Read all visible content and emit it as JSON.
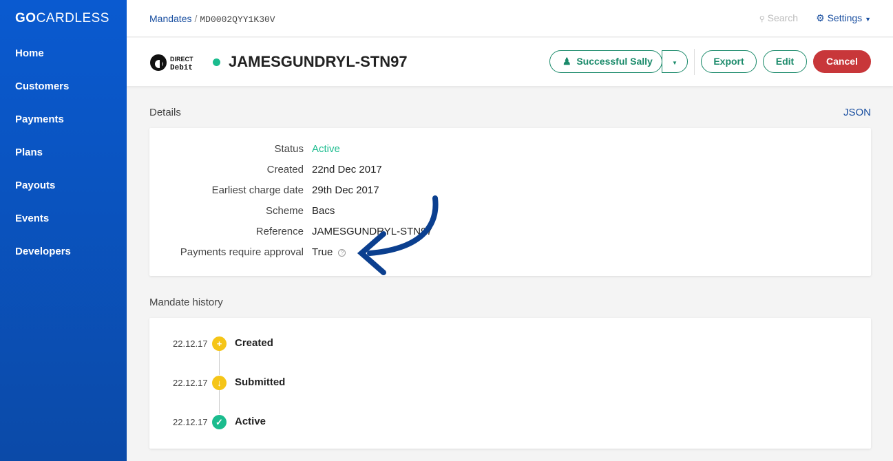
{
  "brand": {
    "bold": "GO",
    "rest": "CARDLESS"
  },
  "sidebar": {
    "items": [
      {
        "label": "Home"
      },
      {
        "label": "Customers"
      },
      {
        "label": "Payments"
      },
      {
        "label": "Plans"
      },
      {
        "label": "Payouts"
      },
      {
        "label": "Events"
      },
      {
        "label": "Developers"
      }
    ]
  },
  "topbar": {
    "breadcrumb_parent": "Mandates",
    "breadcrumb_sep": "/",
    "breadcrumb_id": "MD0002QYY1K30V",
    "search_placeholder": "Search",
    "settings_label": "Settings"
  },
  "header": {
    "logo_text": "DIRECT Debit",
    "title": "JAMESGUNDRYL-STN97",
    "status_color": "#1bbc8e",
    "customer_button": "Successful Sally",
    "export": "Export",
    "edit": "Edit",
    "cancel": "Cancel"
  },
  "details": {
    "label": "Details",
    "json_link": "JSON",
    "rows": [
      {
        "key": "Status",
        "value": "Active"
      },
      {
        "key": "Created",
        "value": "22nd Dec 2017"
      },
      {
        "key": "Earliest charge date",
        "value": "29th Dec 2017"
      },
      {
        "key": "Scheme",
        "value": "Bacs"
      },
      {
        "key": "Reference",
        "value": "JAMESGUNDRYL-STN97"
      },
      {
        "key": "Payments require approval",
        "value": "True"
      }
    ]
  },
  "history": {
    "label": "Mandate history",
    "events": [
      {
        "date": "22.12.17",
        "label": "Created",
        "icon": "plus-icon",
        "color": "#f5c518"
      },
      {
        "date": "22.12.17",
        "label": "Submitted",
        "icon": "arrow-down-icon",
        "color": "#f5c518"
      },
      {
        "date": "22.12.17",
        "label": "Active",
        "icon": "check-icon",
        "color": "#1bbc8e"
      }
    ]
  },
  "colors": {
    "sidebar": "#0b52c0",
    "accent": "#1a8a6a",
    "cancel": "#c8373a",
    "link": "#1a4fa0"
  }
}
